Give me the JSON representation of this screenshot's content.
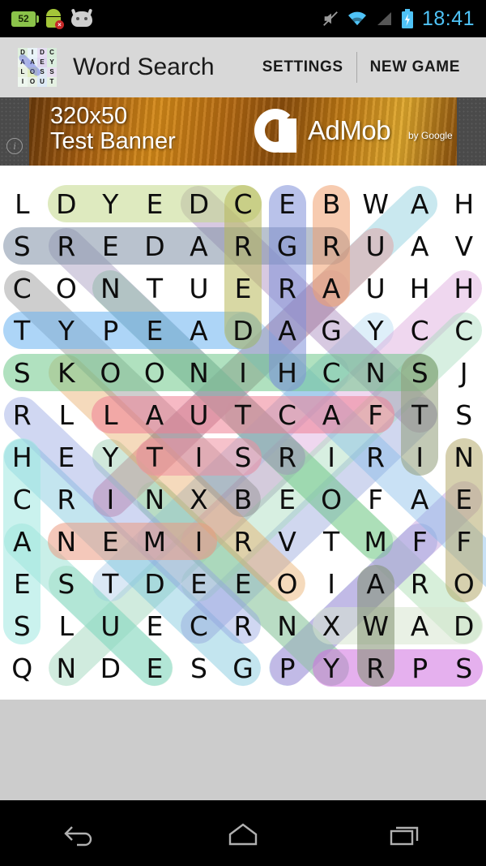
{
  "status_bar": {
    "battery_percent": "52",
    "time": "18:41",
    "icons": [
      "battery-level-icon",
      "android-error-icon",
      "android-face-icon",
      "mute-icon",
      "wifi-icon",
      "signal-icon",
      "battery-charging-icon"
    ]
  },
  "action_bar": {
    "title": "Word Search",
    "settings_label": "SETTINGS",
    "new_game_label": "NEW GAME",
    "app_icon_letters": [
      "D",
      "I",
      "D",
      "C",
      "A",
      "A",
      "E",
      "Y",
      "L",
      "O",
      "S",
      "S",
      "I",
      "O",
      "U",
      "T"
    ]
  },
  "ad": {
    "line1": "320x50",
    "line2": "Test Banner",
    "brand": "AdMob",
    "by": "by Google",
    "info_label": "i"
  },
  "game": {
    "columns": 11,
    "rows": 12,
    "grid": [
      [
        "L",
        "D",
        "Y",
        "E",
        "D",
        "C",
        "E",
        "B",
        "W",
        "A",
        "H"
      ],
      [
        "S",
        "R",
        "E",
        "D",
        "A",
        "R",
        "G",
        "R",
        "U",
        "A",
        "V"
      ],
      [
        "C",
        "O",
        "N",
        "T",
        "U",
        "E",
        "R",
        "A",
        "U",
        "H",
        "H"
      ],
      [
        "T",
        "Y",
        "P",
        "E",
        "A",
        "D",
        "A",
        "G",
        "Y",
        "C",
        "C"
      ],
      [
        "S",
        "K",
        "O",
        "O",
        "N",
        "I",
        "H",
        "C",
        "N",
        "S",
        "J"
      ],
      [
        "R",
        "L",
        "L",
        "A",
        "U",
        "T",
        "C",
        "A",
        "F",
        "T",
        "S"
      ],
      [
        "H",
        "E",
        "Y",
        "T",
        "I",
        "S",
        "R",
        "I",
        "R",
        "I",
        "N"
      ],
      [
        "C",
        "R",
        "I",
        "N",
        "X",
        "B",
        "E",
        "O",
        "F",
        "A",
        "E"
      ],
      [
        "A",
        "N",
        "E",
        "M",
        "I",
        "R",
        "V",
        "T",
        "M",
        "F",
        "F"
      ],
      [
        "E",
        "S",
        "T",
        "D",
        "E",
        "E",
        "O",
        "I",
        "A",
        "R",
        "O"
      ],
      [
        "S",
        "L",
        "U",
        "E",
        "C",
        "R",
        "N",
        "X",
        "W",
        "A",
        "D"
      ],
      [
        "Q",
        "N",
        "D",
        "E",
        "S",
        "G",
        "P",
        "Y",
        "R",
        "P",
        "S"
      ]
    ],
    "found_words": [
      {
        "word": "DYED",
        "start": [
          0,
          1
        ],
        "end": [
          0,
          5
        ],
        "color": "#c3d98a",
        "dir": "h"
      },
      {
        "word": "GRADERS",
        "start": [
          1,
          0
        ],
        "end": [
          1,
          7
        ],
        "color": "#7f8fa6",
        "dir": "h"
      },
      {
        "word": "TYPEAD",
        "start": [
          3,
          0
        ],
        "end": [
          3,
          5
        ],
        "color": "#6ab2f0",
        "dir": "h"
      },
      {
        "word": "SNOOKS",
        "start": [
          4,
          0
        ],
        "end": [
          4,
          9
        ],
        "color": "#6fc98a",
        "dir": "h"
      },
      {
        "word": "FACTUAL",
        "start": [
          5,
          2
        ],
        "end": [
          5,
          8
        ],
        "color": "#ef7f94",
        "dir": "h"
      },
      {
        "word": "TIS",
        "start": [
          6,
          3
        ],
        "end": [
          6,
          5
        ],
        "color": "#ef8fa0",
        "dir": "h"
      },
      {
        "word": "NEM",
        "start": [
          8,
          1
        ],
        "end": [
          8,
          4
        ],
        "color": "#eb9b82",
        "dir": "h"
      },
      {
        "word": "XWAD",
        "start": [
          10,
          7
        ],
        "end": [
          10,
          10
        ],
        "color": "#d7e6d0",
        "dir": "h"
      },
      {
        "word": "YRPS",
        "start": [
          11,
          7
        ],
        "end": [
          11,
          10
        ],
        "color": "#d06fe0",
        "dir": "h"
      },
      {
        "word": "CEDAR",
        "start": [
          0,
          5
        ],
        "end": [
          3,
          5
        ],
        "color": "#b8b85a",
        "dir": "v"
      },
      {
        "word": "ERGA",
        "start": [
          0,
          6
        ],
        "end": [
          4,
          6
        ],
        "color": "#7f8fd8",
        "dir": "v"
      },
      {
        "word": "BRA",
        "start": [
          0,
          7
        ],
        "end": [
          2,
          7
        ],
        "color": "#f0a070",
        "dir": "v"
      },
      {
        "word": "SCAE",
        "start": [
          6,
          0
        ],
        "end": [
          10,
          0
        ],
        "color": "#9fe8e0",
        "dir": "v"
      },
      {
        "word": "SNJ",
        "start": [
          4,
          9
        ],
        "end": [
          6,
          9
        ],
        "color": "#8f9c78",
        "dir": "v"
      },
      {
        "word": "NEFF",
        "start": [
          6,
          10
        ],
        "end": [
          9,
          10
        ],
        "color": "#b5a96b",
        "dir": "v"
      },
      {
        "word": "PYRP",
        "start": [
          9,
          8
        ],
        "end": [
          11,
          8
        ],
        "color": "#7f8f70",
        "dir": "v"
      }
    ]
  },
  "navigation": {
    "back_label": "back-button",
    "home_label": "home-button",
    "recents_label": "recents-button"
  },
  "colors": {
    "status_bar_bg": "#000000",
    "action_bar_bg": "#d8d8d8",
    "accent_time": "#4fc3f7",
    "board_bg": "#ffffff",
    "empty_bg": "#cccccc"
  }
}
